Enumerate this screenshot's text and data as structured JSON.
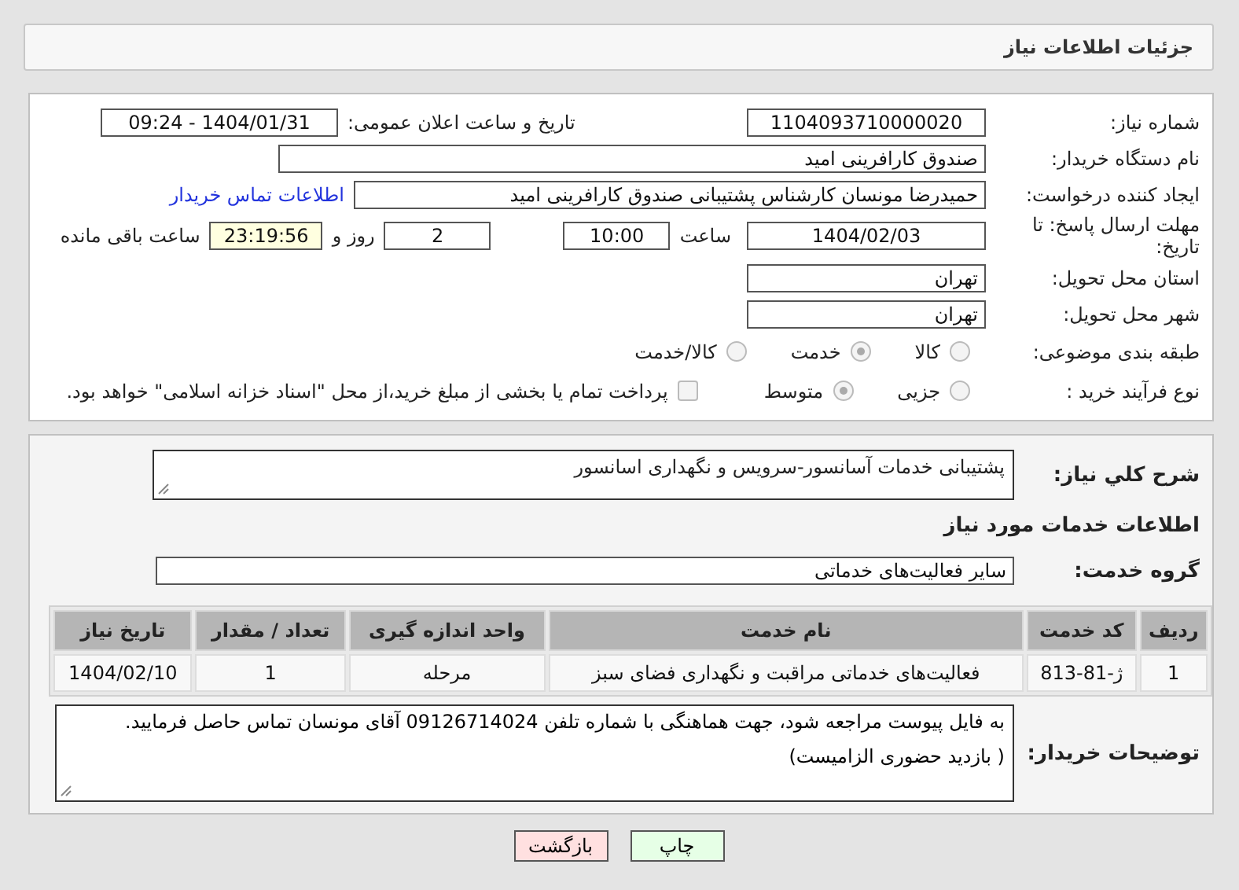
{
  "header": {
    "title": "جزئیات اطلاعات نیاز"
  },
  "details": {
    "need_number": {
      "label": "شماره نیاز:",
      "value": "1104093710000020"
    },
    "announce": {
      "label": "تاریخ و ساعت اعلان عمومی:",
      "value": "1404/01/31 - 09:24"
    },
    "buyer": {
      "label": "نام دستگاه خریدار:",
      "value": "صندوق کارافرینی امید"
    },
    "creator": {
      "label": "ایجاد کننده درخواست:",
      "value": "حمیدرضا مونسان کارشناس پشتیبانی صندوق کارافرینی امید",
      "link": "اطلاعات تماس خریدار"
    },
    "deadline": {
      "label": "مهلت ارسال پاسخ: تا تاریخ:",
      "date": "1404/02/03",
      "time_label": "ساعت",
      "time": "10:00",
      "days": "2",
      "days_label": "روز و",
      "remaining": "23:19:56",
      "remaining_label": "ساعت باقی مانده"
    },
    "province": {
      "label": "استان محل تحویل:",
      "value": "تهران"
    },
    "city": {
      "label": "شهر محل تحویل:",
      "value": "تهران"
    },
    "category": {
      "label": "طبقه بندی موضوعی:",
      "options": [
        {
          "label": "کالا",
          "selected": false
        },
        {
          "label": "خدمت",
          "selected": true
        },
        {
          "label": "کالا/خدمت",
          "selected": false
        }
      ]
    },
    "process": {
      "label": "نوع فرآیند خرید :",
      "options": [
        {
          "label": "جزیی",
          "selected": false
        },
        {
          "label": "متوسط",
          "selected": true
        }
      ],
      "payment": {
        "label": "پرداخت تمام یا بخشی از مبلغ خرید،از محل \"اسناد خزانه اسلامی\" خواهد بود.",
        "checked": false
      }
    }
  },
  "needs": {
    "summary": {
      "label": "شرح کلي نیاز:",
      "value": "پشتیبانی خدمات آسانسور-سرویس و نگهداری اسانسور"
    },
    "section_title": "اطلاعات خدمات مورد نیاز",
    "service_group": {
      "label": "گروه خدمت:",
      "value": "سایر فعالیت‌های خدماتی"
    },
    "table": {
      "columns": [
        "ردیف",
        "کد خدمت",
        "نام خدمت",
        "واحد اندازه گیری",
        "تعداد / مقدار",
        "تاریخ نیاز"
      ],
      "rows": [
        [
          "1",
          "ژ-81-813",
          "فعالیت‌های خدماتی مراقبت و نگهداری فضای سبز",
          "مرحله",
          "1",
          "1404/02/10"
        ]
      ]
    },
    "notes": {
      "label": "توضیحات خریدار:",
      "lines": [
        "به فایل پیوست مراجعه شود، جهت هماهنگی با شماره تلفن 09126714024 آقای مونسان تماس حاصل فرمایید.",
        "( بازدید حضوری الزامیست)"
      ]
    }
  },
  "buttons": [
    {
      "label": "چاپ",
      "kind": "print"
    },
    {
      "label": "بازگشت",
      "kind": "back"
    }
  ]
}
